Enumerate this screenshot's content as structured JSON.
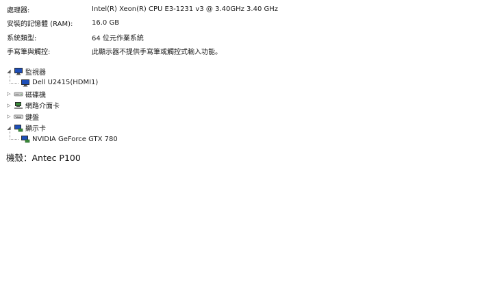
{
  "system_info": {
    "rows": [
      {
        "label": "處理器:",
        "value": "Intel(R) Xeon(R) CPU E3-1231 v3 @ 3.40GHz   3.40 GHz"
      },
      {
        "label": "安裝的記憶體 (RAM):",
        "value": "16.0 GB"
      },
      {
        "label": "系統類型:",
        "value": "64 位元作業系統"
      },
      {
        "label": "手寫筆與觸控:",
        "value": "此顯示器不提供手寫筆或觸控式輸入功能。"
      }
    ]
  },
  "device_tree": {
    "monitors": {
      "label": "監視器",
      "expanded": true,
      "icon": "monitor-icon"
    },
    "monitor_child": {
      "label": "Dell U2415(HDMI1)",
      "icon": "monitor-icon"
    },
    "disk_drives": {
      "label": "磁碟機",
      "expanded": false,
      "icon": "disk-drive-icon"
    },
    "network_adapters": {
      "label": "網路介面卡",
      "expanded": false,
      "icon": "network-adapter-icon"
    },
    "keyboards": {
      "label": "鍵盤",
      "expanded": false,
      "icon": "keyboard-icon"
    },
    "display_adapters": {
      "label": "顯示卡",
      "expanded": true,
      "icon": "display-adapter-icon"
    },
    "display_child": {
      "label": "NVIDIA GeForce GTX 780",
      "icon": "display-adapter-icon"
    }
  },
  "caption": "機殼：Antec P100",
  "colors": {
    "text": "#1a1a1a",
    "monitor_screen": "#1e4fb8",
    "background": "#ffffff"
  }
}
